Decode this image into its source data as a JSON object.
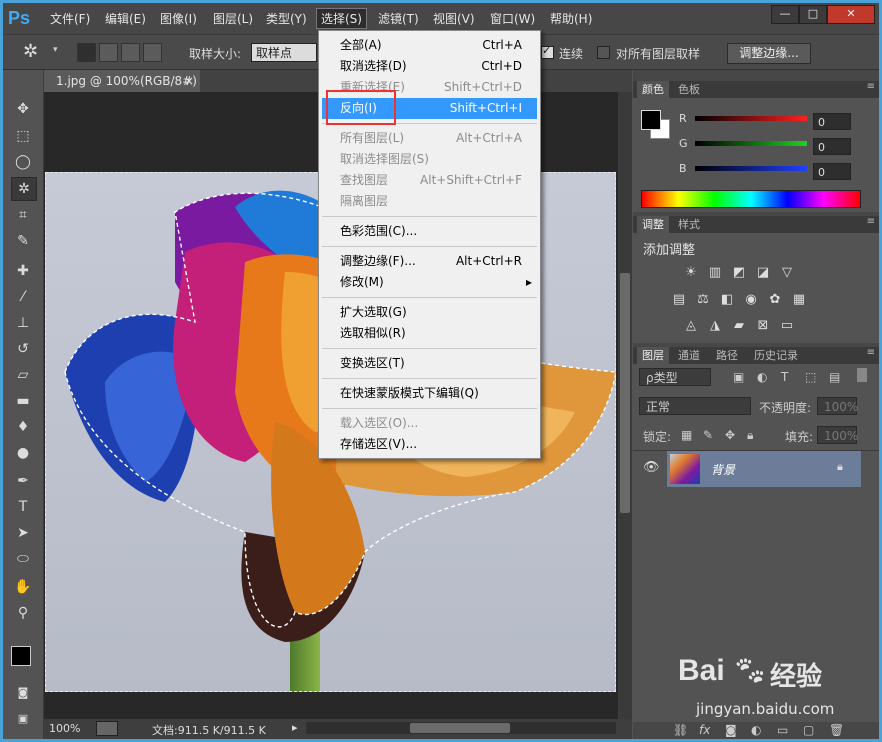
{
  "menubar": {
    "logo": "Ps",
    "items": [
      "文件(F)",
      "编辑(E)",
      "图像(I)",
      "图层(L)",
      "类型(Y)",
      "选择(S)",
      "滤镜(T)",
      "视图(V)",
      "窗口(W)",
      "帮助(H)"
    ],
    "active_index": 5
  },
  "window_buttons": [
    "—",
    "□",
    "✕"
  ],
  "options": {
    "sample_size_label": "取样大小:",
    "sample_size_value": "取样点",
    "contiguous_label": "连续",
    "all_layers_label": "对所有图层取样",
    "refine_edge_button": "调整边缘..."
  },
  "document": {
    "tab_title": "1.jpg @ 100%(RGB/8#)",
    "tab_close": "×",
    "zoom": "100%",
    "doc_info": "文档:911.5 K/911.5 K"
  },
  "select_menu": {
    "items": [
      {
        "label": "全部(A)",
        "shortcut": "Ctrl+A",
        "disabled": false
      },
      {
        "label": "取消选择(D)",
        "shortcut": "Ctrl+D",
        "disabled": false
      },
      {
        "label": "重新选择(E)",
        "shortcut": "Shift+Ctrl+D",
        "disabled": true
      },
      {
        "label": "反向(I)",
        "shortcut": "Shift+Ctrl+I",
        "disabled": false,
        "highlighted": true
      },
      {
        "label": "所有图层(L)",
        "shortcut": "Alt+Ctrl+A",
        "disabled": true
      },
      {
        "label": "取消选择图层(S)",
        "shortcut": "",
        "disabled": true
      },
      {
        "label": "查找图层",
        "shortcut": "Alt+Shift+Ctrl+F",
        "disabled": true
      },
      {
        "label": "隔离图层",
        "shortcut": "",
        "disabled": true
      },
      {
        "label": "色彩范围(C)...",
        "shortcut": "",
        "disabled": false
      },
      {
        "label": "调整边缘(F)...",
        "shortcut": "Alt+Ctrl+R",
        "disabled": false
      },
      {
        "label": "修改(M)",
        "shortcut": "▸",
        "disabled": false
      },
      {
        "label": "扩大选取(G)",
        "shortcut": "",
        "disabled": false
      },
      {
        "label": "选取相似(R)",
        "shortcut": "",
        "disabled": false
      },
      {
        "label": "变换选区(T)",
        "shortcut": "",
        "disabled": false
      },
      {
        "label": "在快速蒙版模式下编辑(Q)",
        "shortcut": "",
        "disabled": false
      },
      {
        "label": "载入选区(O)...",
        "shortcut": "",
        "disabled": true
      },
      {
        "label": "存储选区(V)...",
        "shortcut": "",
        "disabled": false
      }
    ]
  },
  "color_panel": {
    "tabs": [
      "颜色",
      "色板"
    ],
    "channels": [
      {
        "name": "R",
        "value": "0",
        "color": "#ff2020"
      },
      {
        "name": "G",
        "value": "0",
        "color": "#20d020"
      },
      {
        "name": "B",
        "value": "0",
        "color": "#2040ff"
      }
    ]
  },
  "adjust_panel": {
    "tabs": [
      "调整",
      "样式"
    ],
    "title": "添加调整"
  },
  "layers_panel": {
    "tabs": [
      "图层",
      "通道",
      "路径",
      "历史记录"
    ],
    "filter_label": "ρ类型",
    "blend_mode": "正常",
    "opacity_label": "不透明度:",
    "opacity_value": "100%",
    "lock_label": "锁定:",
    "fill_label": "填充:",
    "fill_value": "100%",
    "layer_name": "背景"
  },
  "watermark": {
    "brand": "Bai",
    "brand2": "经验",
    "url": "jingyan.baidu.com"
  }
}
